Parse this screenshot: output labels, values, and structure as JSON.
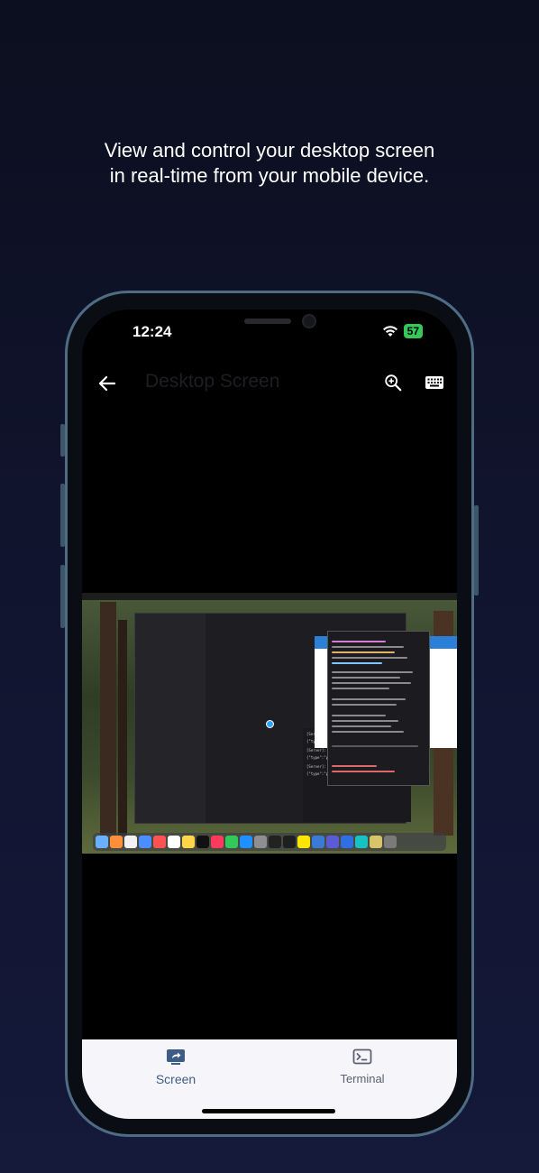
{
  "headline": {
    "line1": "View and control your desktop screen",
    "line2": "in real-time from your mobile device."
  },
  "status_bar": {
    "time": "12:24",
    "battery": "57",
    "icons": [
      "wifi-icon",
      "battery-icon"
    ]
  },
  "app_bar": {
    "title": "Desktop Screen",
    "back_icon": "arrow-left-icon",
    "zoom_icon": "zoom-in-icon",
    "keyboard_icon": "keyboard-icon"
  },
  "remote_desktop": {
    "description_source": "screenshot-of-remote-mac-desktop"
  },
  "bottom_nav": {
    "items": [
      {
        "label": "Screen",
        "icon": "screen-share-icon",
        "active": true
      },
      {
        "label": "Terminal",
        "icon": "terminal-icon",
        "active": false
      }
    ]
  },
  "colors": {
    "background": "#111530",
    "active_tab": "#3d5d86",
    "inactive_tab": "#5b6170",
    "battery": "#34c759"
  }
}
